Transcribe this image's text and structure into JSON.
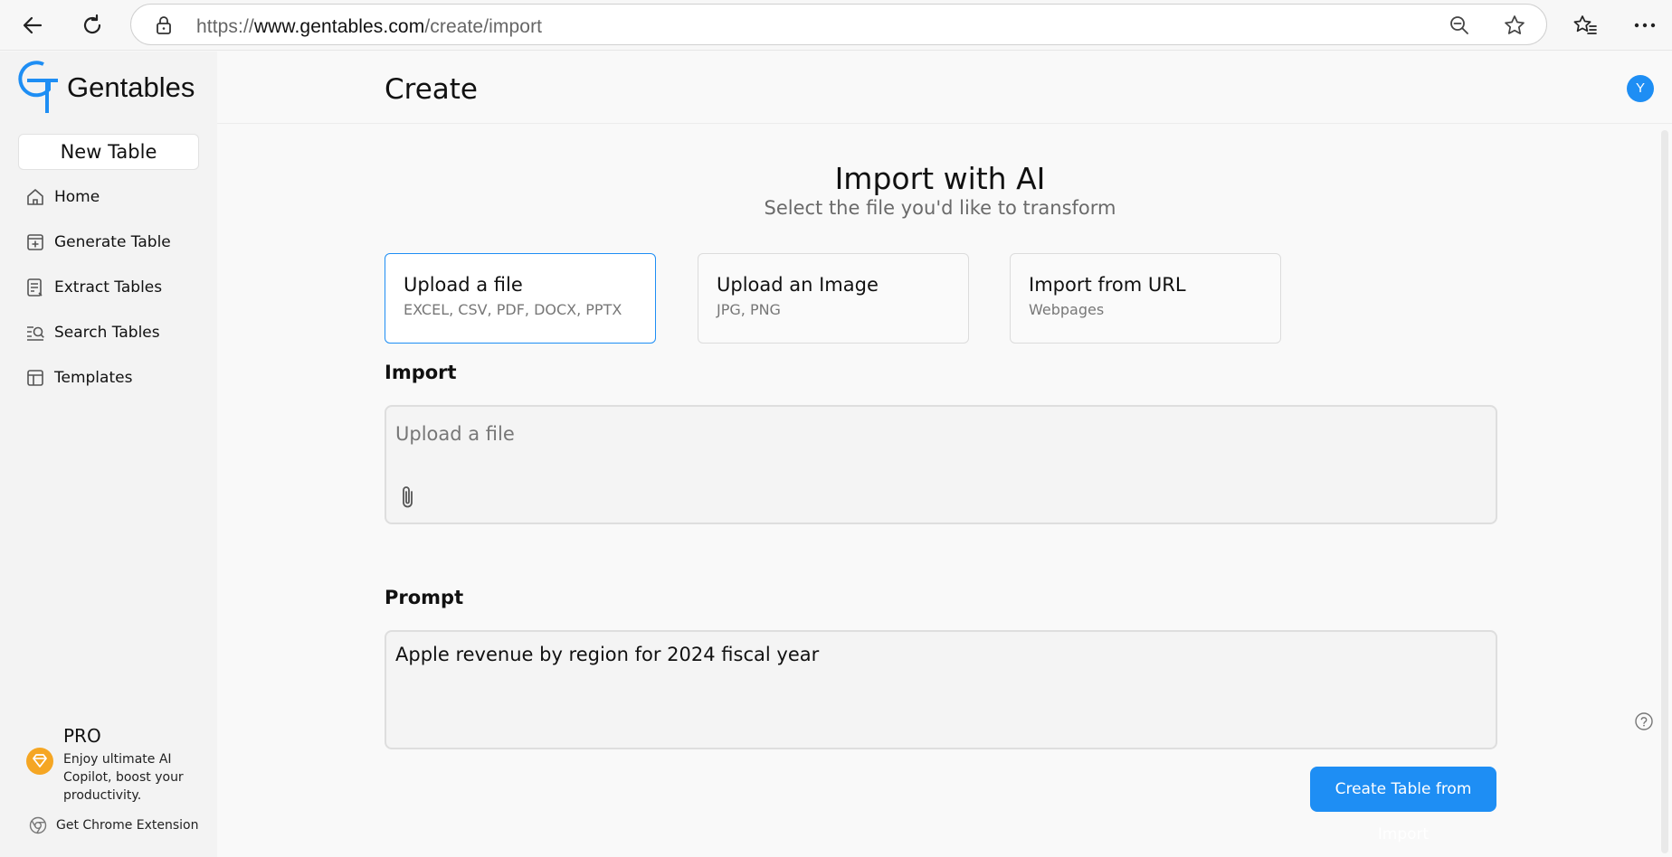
{
  "browser": {
    "url_scheme": "https://",
    "url_host": "www.gentables.com",
    "url_path": "/create/import"
  },
  "sidebar": {
    "logo_text": "Gentables",
    "new_table_label": "New Table",
    "items": [
      {
        "label": "Home",
        "icon": "home-icon"
      },
      {
        "label": "Generate Table",
        "icon": "plus-square-icon"
      },
      {
        "label": "Extract Tables",
        "icon": "document-list-icon"
      },
      {
        "label": "Search Tables",
        "icon": "list-search-icon"
      },
      {
        "label": "Templates",
        "icon": "layout-icon"
      }
    ],
    "pro": {
      "title": "PRO",
      "description": "Enjoy ultimate AI Copilot, boost your productivity."
    },
    "chrome_extension_label": "Get Chrome Extension"
  },
  "header": {
    "title": "Create",
    "avatar_initial": "Y"
  },
  "main": {
    "hero_title": "Import with AI",
    "hero_subtitle": "Select the file you'd like to transform",
    "options": [
      {
        "title": "Upload a file",
        "subtitle": "EXCEL, CSV, PDF, DOCX, PPTX",
        "selected": true
      },
      {
        "title": "Upload an Image",
        "subtitle": "JPG, PNG",
        "selected": false
      },
      {
        "title": "Import from URL",
        "subtitle": "Webpages",
        "selected": false
      }
    ],
    "import_label": "Import",
    "import_placeholder": "Upload a file",
    "prompt_label": "Prompt",
    "prompt_value": "Apple revenue by region for 2024 fiscal year",
    "create_button_label": "Create Table from Import"
  },
  "colors": {
    "accent": "#1e8ef4",
    "pro_badge": "#f5a623"
  }
}
